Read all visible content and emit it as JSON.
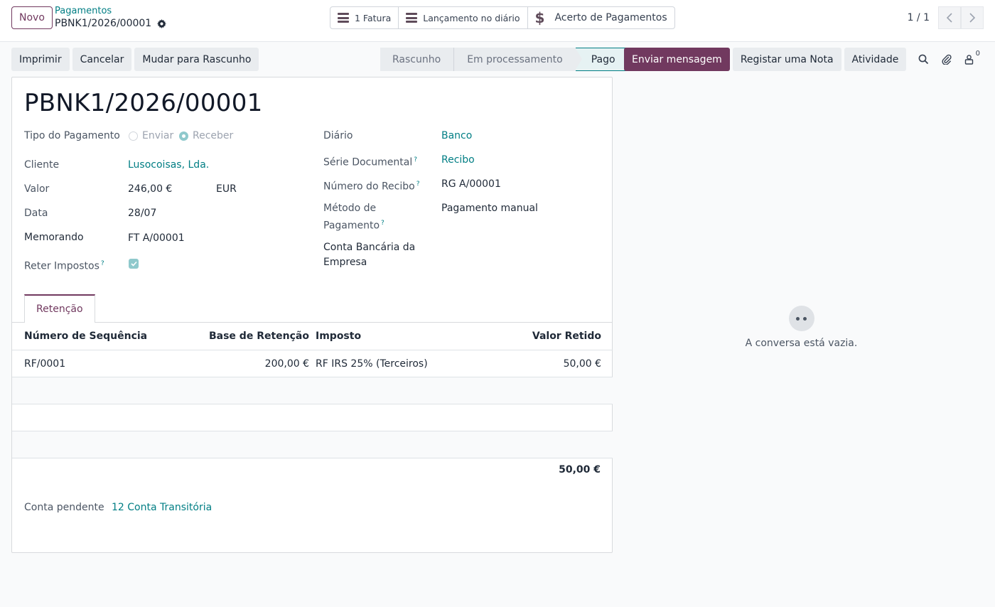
{
  "control_panel": {
    "new_button": "Novo",
    "breadcrumb_parent": "Pagamentos",
    "breadcrumb_current": "PBNK1/2026/00001",
    "smart_buttons": {
      "invoice": "1 Fatura",
      "journal": "Lançamento no diário",
      "reconcile": "Acerto de Pagamentos"
    },
    "pager": "1 / 1"
  },
  "actions": {
    "print": "Imprimir",
    "cancel": "Cancelar",
    "draft": "Mudar para Rascunho"
  },
  "statusbar": {
    "steps": [
      "Rascunho",
      "Em processamento",
      "Pago"
    ],
    "active": "Pago"
  },
  "chatter": {
    "send_message": "Enviar mensagem",
    "log_note": "Registar uma Nota",
    "activity": "Atividade",
    "followers_count": "0",
    "empty_text": "A conversa está vazia."
  },
  "form": {
    "title": "PBNK1/2026/00001",
    "left": {
      "payment_type_label": "Tipo do Pagamento",
      "payment_type_options": [
        "Enviar",
        "Receber"
      ],
      "payment_type_selected": "Receber",
      "customer_label": "Cliente",
      "customer_value": "Lusocoisas, Lda.",
      "amount_label": "Valor",
      "amount_value": "246,00 €",
      "currency_value": "EUR",
      "date_label": "Data",
      "date_value": "28/07",
      "memo_label": "Memorando",
      "memo_value": "FT A/00001",
      "withhold_label": "Reter Impostos",
      "withhold_checked": true
    },
    "right": {
      "journal_label": "Diário",
      "journal_value": "Banco",
      "series_label": "Série Documental",
      "series_value": "Recibo",
      "receipt_label": "Número do Recibo",
      "receipt_value": "RG A/00001",
      "method_label_line1": "Método de",
      "method_label_line2": "Pagamento",
      "method_value": "Pagamento manual",
      "bank_label_line1": "Conta Bancária da",
      "bank_label_line2": "Empresa"
    },
    "tab": "Retenção",
    "table": {
      "headers": [
        "Número de Sequência",
        "Base de Retenção",
        "Imposto",
        "Valor Retido"
      ],
      "rows": [
        [
          "RF/0001",
          "200,00 €",
          "RF IRS 25% (Terceiros)",
          "50,00 €"
        ]
      ],
      "total": "50,00 €"
    },
    "pending_label": "Conta pendente",
    "pending_value": "12 Conta Transitória"
  },
  "colors": {
    "brand": "#71395f",
    "link": "#017e84"
  }
}
